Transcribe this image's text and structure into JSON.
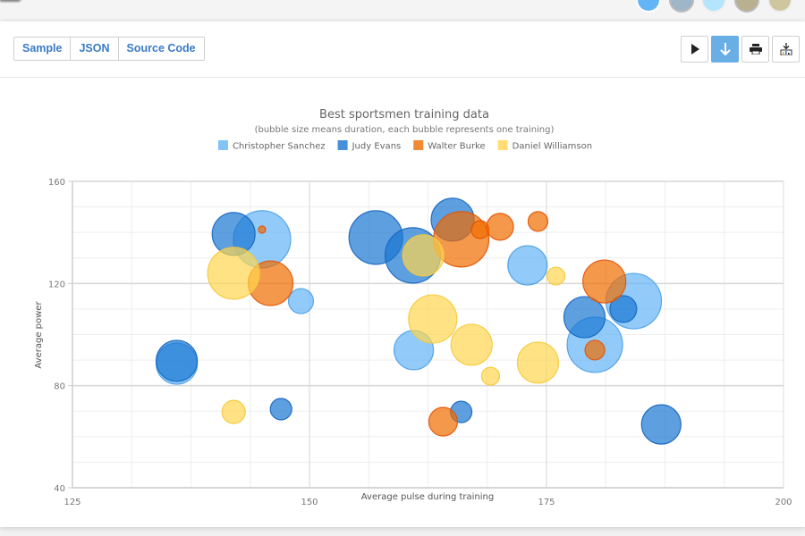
{
  "theme_switcher": {
    "swatches": [
      "#64b5f6",
      "#9fb6c8",
      "#b3e5fc",
      "#b8b08f",
      "#cfc6a0"
    ]
  },
  "toolbar": {
    "tabs": [
      {
        "label": "Sample"
      },
      {
        "label": "JSON"
      },
      {
        "label": "Source Code"
      }
    ],
    "icons": [
      {
        "name": "play-icon",
        "active": false
      },
      {
        "name": "download-arrow-icon",
        "active": true
      },
      {
        "name": "print-icon",
        "active": false
      },
      {
        "name": "export-chart-icon",
        "active": false
      }
    ]
  },
  "chart_data": {
    "type": "scatter",
    "subtype": "bubble",
    "title": "Best sportsmen training data",
    "subtitle": "(bubble size means duration, each bubble represents one training)",
    "xlabel": "Average pulse during training",
    "ylabel": "Average power",
    "xlim": [
      125,
      200
    ],
    "ylim": [
      40,
      160
    ],
    "x_ticks": [
      125,
      150,
      175,
      200
    ],
    "y_ticks": [
      40,
      80,
      120,
      160
    ],
    "x_minor_step": 6.25,
    "y_minor_step": 10,
    "grid": true,
    "legend_position": "top-center",
    "size_max": 32,
    "series": [
      {
        "name": "Christopher Sanchez",
        "color": "#64b5f6",
        "stroke": "#4a9fe6",
        "points": [
          {
            "x": 145,
            "y": 137.3,
            "size": 32
          },
          {
            "x": 149.1,
            "y": 113.1,
            "size": 14
          },
          {
            "x": 136,
            "y": 88.6,
            "size": 23
          },
          {
            "x": 173,
            "y": 127.1,
            "size": 22
          },
          {
            "x": 161,
            "y": 93.9,
            "size": 22
          },
          {
            "x": 184.2,
            "y": 113.1,
            "size": 31
          },
          {
            "x": 180.1,
            "y": 96,
            "size": 31
          }
        ]
      },
      {
        "name": "Judy Evans",
        "color": "#1976d2",
        "stroke": "#1565c0",
        "points": [
          {
            "x": 142,
            "y": 139.4,
            "size": 24
          },
          {
            "x": 136,
            "y": 89.7,
            "size": 23
          },
          {
            "x": 147,
            "y": 70.8,
            "size": 12
          },
          {
            "x": 157,
            "y": 138,
            "size": 30
          },
          {
            "x": 160.9,
            "y": 131,
            "size": 31
          },
          {
            "x": 165.1,
            "y": 145,
            "size": 24
          },
          {
            "x": 166,
            "y": 69.7,
            "size": 12
          },
          {
            "x": 183.1,
            "y": 110,
            "size": 15
          },
          {
            "x": 179,
            "y": 106.8,
            "size": 23
          },
          {
            "x": 187.1,
            "y": 64.8,
            "size": 22
          }
        ]
      },
      {
        "name": "Walter Burke",
        "color": "#ef6c00",
        "stroke": "#e65100",
        "points": [
          {
            "x": 145,
            "y": 141.1,
            "size": 4
          },
          {
            "x": 145.9,
            "y": 120.1,
            "size": 25
          },
          {
            "x": 166,
            "y": 137.3,
            "size": 31
          },
          {
            "x": 168,
            "y": 141.1,
            "size": 10
          },
          {
            "x": 170.1,
            "y": 142.2,
            "size": 15
          },
          {
            "x": 174.1,
            "y": 144.3,
            "size": 11
          },
          {
            "x": 164.1,
            "y": 65.9,
            "size": 16
          },
          {
            "x": 181.1,
            "y": 120.8,
            "size": 24
          },
          {
            "x": 180.1,
            "y": 93.9,
            "size": 11
          }
        ]
      },
      {
        "name": "Daniel Williamson",
        "color": "#ffd54f",
        "stroke": "#f5c93a",
        "points": [
          {
            "x": 142,
            "y": 124,
            "size": 29
          },
          {
            "x": 142,
            "y": 69.7,
            "size": 13
          },
          {
            "x": 162,
            "y": 131,
            "size": 23
          },
          {
            "x": 176,
            "y": 122.9,
            "size": 10
          },
          {
            "x": 163,
            "y": 106.1,
            "size": 27
          },
          {
            "x": 167.1,
            "y": 96,
            "size": 23
          },
          {
            "x": 169.1,
            "y": 83.7,
            "size": 10
          },
          {
            "x": 174.1,
            "y": 89,
            "size": 23
          }
        ]
      }
    ]
  }
}
